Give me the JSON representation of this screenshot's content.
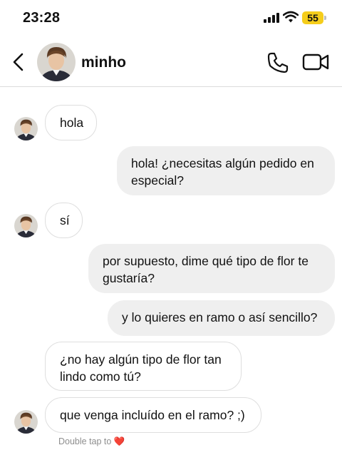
{
  "status_bar": {
    "time": "23:28",
    "battery": "55",
    "battery_color": "#f5cd1b"
  },
  "header": {
    "contact_name": "minho",
    "icons": [
      "chevron-left-icon",
      "phone-icon",
      "video-camera-icon"
    ]
  },
  "messages": [
    {
      "direction": "incoming",
      "text": "hola"
    },
    {
      "direction": "outgoing",
      "text": "hola! ¿necesitas algún pedido en especial?"
    },
    {
      "direction": "incoming",
      "text": "sí"
    },
    {
      "direction": "outgoing",
      "text": "por supuesto, dime qué tipo de flor te gustaría?"
    },
    {
      "direction": "outgoing",
      "text": "y lo quieres en ramo o así sencillo?"
    },
    {
      "direction": "incoming",
      "text": "¿no hay algún tipo de flor tan lindo como tú?"
    },
    {
      "direction": "incoming",
      "text": "que venga incluído en el ramo? ;)"
    }
  ],
  "hint": {
    "text": "Double tap to",
    "emoji": "❤️"
  },
  "colors": {
    "outgoing_bubble": "#efefef",
    "incoming_border": "#dedede",
    "divider": "#dcdcdc"
  }
}
